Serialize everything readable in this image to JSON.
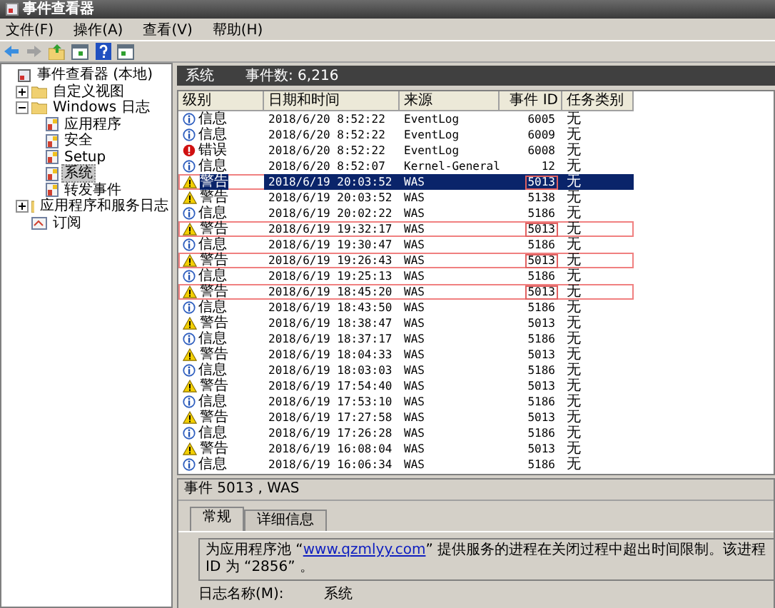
{
  "window": {
    "title": "事件查看器"
  },
  "menu": [
    "文件(F)",
    "操作(A)",
    "查看(V)",
    "帮助(H)"
  ],
  "tree": [
    {
      "label": "事件查看器 (本地)",
      "kind": "viewer",
      "selected": false,
      "children": [
        {
          "label": "自定义视图",
          "kind": "folder",
          "selected": false,
          "expanded": false
        },
        {
          "label": "Windows 日志",
          "kind": "folder",
          "selected": false,
          "expanded": true,
          "children": [
            {
              "label": "应用程序",
              "kind": "log",
              "selected": false
            },
            {
              "label": "安全",
              "kind": "log",
              "selected": false
            },
            {
              "label": "Setup",
              "kind": "log",
              "selected": false
            },
            {
              "label": "系统",
              "kind": "log",
              "selected": true
            },
            {
              "label": "转发事件",
              "kind": "log",
              "selected": false
            }
          ]
        },
        {
          "label": "应用程序和服务日志",
          "kind": "folder",
          "selected": false,
          "expanded": false
        },
        {
          "label": "订阅",
          "kind": "subscription",
          "selected": false
        }
      ]
    }
  ],
  "log_header": {
    "name": "系统",
    "count": "事件数: 6,216"
  },
  "table": {
    "columns": [
      "级别",
      "日期和时间",
      "来源",
      "事件 ID",
      "任务类别"
    ],
    "rows": [
      {
        "kind": "info",
        "level": "信息",
        "datetime": "2018/6/20 8:52:22",
        "source": "EventLog",
        "event_id": "6005",
        "task": "无",
        "selected": false,
        "marked": false,
        "id_marked": false
      },
      {
        "kind": "info",
        "level": "信息",
        "datetime": "2018/6/20 8:52:22",
        "source": "EventLog",
        "event_id": "6009",
        "task": "无",
        "selected": false,
        "marked": false,
        "id_marked": false
      },
      {
        "kind": "error",
        "level": "错误",
        "datetime": "2018/6/20 8:52:22",
        "source": "EventLog",
        "event_id": "6008",
        "task": "无",
        "selected": false,
        "marked": false,
        "id_marked": false
      },
      {
        "kind": "info",
        "level": "信息",
        "datetime": "2018/6/20 8:52:07",
        "source": "Kernel-General",
        "event_id": "12",
        "task": "无",
        "selected": false,
        "marked": false,
        "id_marked": false
      },
      {
        "kind": "warning",
        "level": "警告",
        "datetime": "2018/6/19 20:03:52",
        "source": "WAS",
        "event_id": "5013",
        "task": "无",
        "selected": true,
        "marked": true,
        "id_marked": true
      },
      {
        "kind": "warning",
        "level": "警告",
        "datetime": "2018/6/19 20:03:52",
        "source": "WAS",
        "event_id": "5138",
        "task": "无",
        "selected": false,
        "marked": false,
        "id_marked": false
      },
      {
        "kind": "info",
        "level": "信息",
        "datetime": "2018/6/19 20:02:22",
        "source": "WAS",
        "event_id": "5186",
        "task": "无",
        "selected": false,
        "marked": false,
        "id_marked": false
      },
      {
        "kind": "warning",
        "level": "警告",
        "datetime": "2018/6/19 19:32:17",
        "source": "WAS",
        "event_id": "5013",
        "task": "无",
        "selected": false,
        "marked": true,
        "id_marked": true
      },
      {
        "kind": "info",
        "level": "信息",
        "datetime": "2018/6/19 19:30:47",
        "source": "WAS",
        "event_id": "5186",
        "task": "无",
        "selected": false,
        "marked": false,
        "id_marked": false
      },
      {
        "kind": "warning",
        "level": "警告",
        "datetime": "2018/6/19 19:26:43",
        "source": "WAS",
        "event_id": "5013",
        "task": "无",
        "selected": false,
        "marked": true,
        "id_marked": true
      },
      {
        "kind": "info",
        "level": "信息",
        "datetime": "2018/6/19 19:25:13",
        "source": "WAS",
        "event_id": "5186",
        "task": "无",
        "selected": false,
        "marked": false,
        "id_marked": false
      },
      {
        "kind": "warning",
        "level": "警告",
        "datetime": "2018/6/19 18:45:20",
        "source": "WAS",
        "event_id": "5013",
        "task": "无",
        "selected": false,
        "marked": true,
        "id_marked": true
      },
      {
        "kind": "info",
        "level": "信息",
        "datetime": "2018/6/19 18:43:50",
        "source": "WAS",
        "event_id": "5186",
        "task": "无",
        "selected": false,
        "marked": false,
        "id_marked": false
      },
      {
        "kind": "warning",
        "level": "警告",
        "datetime": "2018/6/19 18:38:47",
        "source": "WAS",
        "event_id": "5013",
        "task": "无",
        "selected": false,
        "marked": false,
        "id_marked": false
      },
      {
        "kind": "info",
        "level": "信息",
        "datetime": "2018/6/19 18:37:17",
        "source": "WAS",
        "event_id": "5186",
        "task": "无",
        "selected": false,
        "marked": false,
        "id_marked": false
      },
      {
        "kind": "warning",
        "level": "警告",
        "datetime": "2018/6/19 18:04:33",
        "source": "WAS",
        "event_id": "5013",
        "task": "无",
        "selected": false,
        "marked": false,
        "id_marked": false
      },
      {
        "kind": "info",
        "level": "信息",
        "datetime": "2018/6/19 18:03:03",
        "source": "WAS",
        "event_id": "5186",
        "task": "无",
        "selected": false,
        "marked": false,
        "id_marked": false
      },
      {
        "kind": "warning",
        "level": "警告",
        "datetime": "2018/6/19 17:54:40",
        "source": "WAS",
        "event_id": "5013",
        "task": "无",
        "selected": false,
        "marked": false,
        "id_marked": false
      },
      {
        "kind": "info",
        "level": "信息",
        "datetime": "2018/6/19 17:53:10",
        "source": "WAS",
        "event_id": "5186",
        "task": "无",
        "selected": false,
        "marked": false,
        "id_marked": false
      },
      {
        "kind": "warning",
        "level": "警告",
        "datetime": "2018/6/19 17:27:58",
        "source": "WAS",
        "event_id": "5013",
        "task": "无",
        "selected": false,
        "marked": false,
        "id_marked": false
      },
      {
        "kind": "info",
        "level": "信息",
        "datetime": "2018/6/19 17:26:28",
        "source": "WAS",
        "event_id": "5186",
        "task": "无",
        "selected": false,
        "marked": false,
        "id_marked": false
      },
      {
        "kind": "warning",
        "level": "警告",
        "datetime": "2018/6/19 16:08:04",
        "source": "WAS",
        "event_id": "5013",
        "task": "无",
        "selected": false,
        "marked": false,
        "id_marked": false
      },
      {
        "kind": "info",
        "level": "信息",
        "datetime": "2018/6/19 16:06:34",
        "source": "WAS",
        "event_id": "5186",
        "task": "无",
        "selected": false,
        "marked": false,
        "id_marked": false
      }
    ]
  },
  "details": {
    "title": "事件 5013 , WAS",
    "tabs": [
      {
        "label": "常规",
        "selected": true
      },
      {
        "label": "详细信息",
        "selected": false
      }
    ],
    "message_before": "为应用程序池 “",
    "message_link": "www.qzmlyy.com",
    "message_after": "” 提供服务的进程在关闭过程中超出时间限制。该进程 ID 为 “2856” 。",
    "log_name_label": "日志名称(M):",
    "log_name": "系统"
  }
}
